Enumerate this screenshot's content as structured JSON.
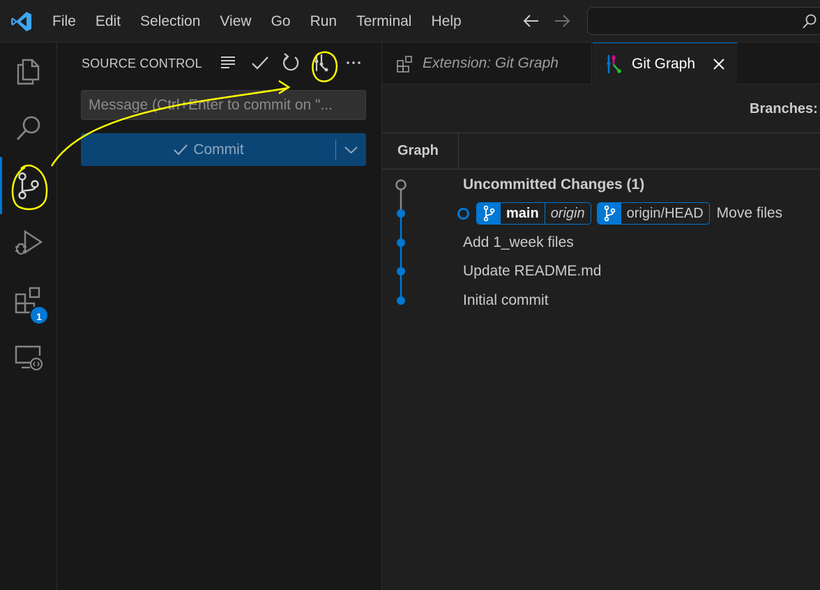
{
  "menu": [
    "File",
    "Edit",
    "Selection",
    "View",
    "Go",
    "Run",
    "Terminal",
    "Help"
  ],
  "activity_bar": {
    "extensions_badge": "1"
  },
  "source_control": {
    "title": "SOURCE CONTROL",
    "message_placeholder": "Message (Ctrl+Enter to commit on \"...",
    "commit_label": "Commit"
  },
  "tabs": [
    {
      "label": "Extension: Git Graph",
      "active": false
    },
    {
      "label": "Git Graph",
      "active": true
    }
  ],
  "git_graph": {
    "branches_label": "Branches:",
    "graph_column": "Graph",
    "commits": [
      {
        "message": "Uncommitted Changes (1)"
      },
      {
        "message": "Move files",
        "refs": {
          "branch": "main",
          "remote": "origin",
          "head": "origin/HEAD"
        }
      },
      {
        "message": "Add 1_week files"
      },
      {
        "message": "Update README.md"
      },
      {
        "message": "Initial commit"
      }
    ]
  },
  "colors": {
    "accent": "#0078d4",
    "annotation": "#ffff00",
    "background": "#1f1f1f"
  }
}
